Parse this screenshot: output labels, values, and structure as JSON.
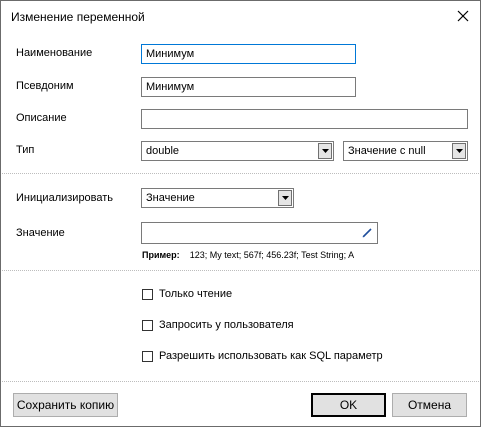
{
  "window": {
    "title": "Изменение переменной"
  },
  "form": {
    "name": {
      "label": "Наименование",
      "value": "Минимум"
    },
    "alias": {
      "label": "Псевдоним",
      "value": "Минимум"
    },
    "description": {
      "label": "Описание",
      "value": ""
    },
    "type": {
      "label": "Тип",
      "value": "double",
      "nullable": "Значение с null"
    },
    "initialize": {
      "label": "Инициализировать",
      "value": "Значение"
    },
    "value": {
      "label": "Значение",
      "value": ""
    },
    "example": {
      "prefix": "Пример:",
      "text": "123; My text; 567f; 456.23f; Test String; A"
    }
  },
  "options": {
    "readonly": "Только чтение",
    "ask_user": "Запросить у пользователя",
    "sql_param": "Разрешить использовать как SQL параметр"
  },
  "buttons": {
    "save_copy": "Сохранить копию",
    "ok": "OK",
    "cancel": "Отмена"
  },
  "colors": {
    "focus_border": "#0078d7",
    "button_face": "#e1e1e1"
  },
  "icons": {
    "close": "close-icon",
    "combo_arrow": "chevron-down-icon",
    "edit": "pencil-icon"
  }
}
